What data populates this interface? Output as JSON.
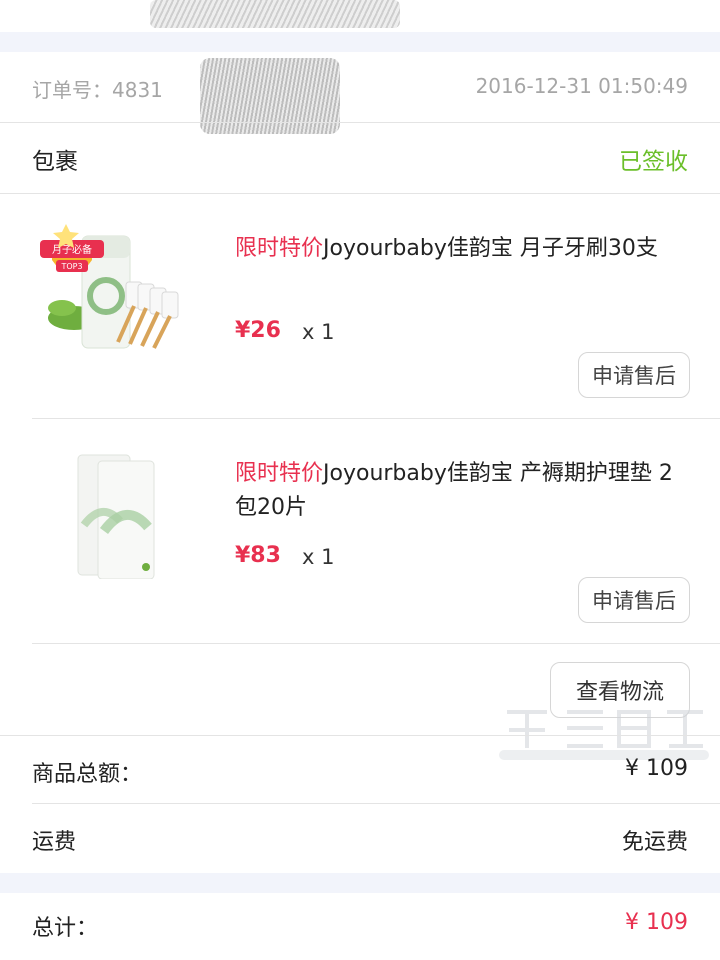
{
  "order": {
    "number_label": "订单号：4831",
    "time": "2016-12-31 01:50:49"
  },
  "package": {
    "label": "包裹",
    "status": "已签收",
    "status_color": "#6bbf2a"
  },
  "items": [
    {
      "promo": "限时特价",
      "name": "Joyourbaby佳韵宝 月子牙刷30支",
      "price": "¥26",
      "qty": "x 1",
      "action": "申请售后",
      "badge_text": "月子必备",
      "badge_rank": "TOP3",
      "image_icon": "toothbrush-product-image"
    },
    {
      "promo": "限时特价",
      "name": "Joyourbaby佳韵宝 产褥期护理垫 2包20片",
      "price": "¥83",
      "qty": "x 1",
      "action": "申请售后",
      "image_icon": "nursing-pad-product-image"
    }
  ],
  "logistics_button": "查看物流",
  "summary": {
    "subtotal_label": "商品总额：",
    "subtotal_value": "¥ 109",
    "shipping_label": "运费",
    "shipping_value": "免运费",
    "total_label": "总计：",
    "total_value": "¥ 109"
  },
  "colors": {
    "accent_red": "#e8304f",
    "status_green": "#6bbf2a",
    "muted_gray": "#a6a6a6"
  }
}
